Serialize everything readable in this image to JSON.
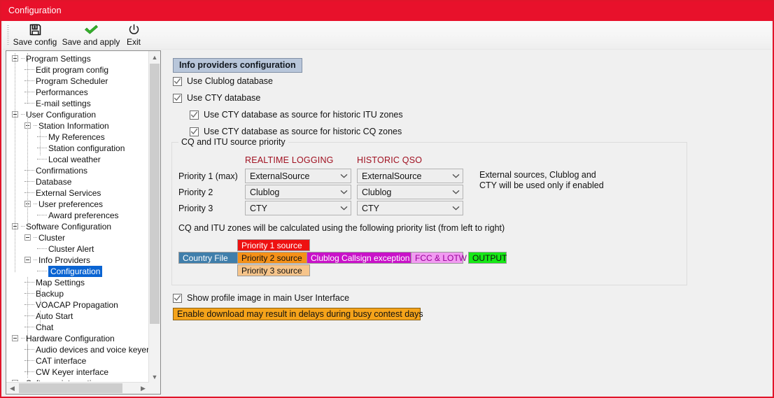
{
  "window": {
    "title": "Configuration",
    "accent_color": "#e8112b"
  },
  "toolbar": {
    "buttons": [
      {
        "label": "Save config",
        "icon": "floppy-disk-icon"
      },
      {
        "label": "Save and apply",
        "icon": "green-check-icon"
      },
      {
        "label": "Exit",
        "icon": "power-icon"
      }
    ]
  },
  "tree": {
    "items": [
      {
        "label": "Program Settings",
        "depth": 0,
        "expander": true,
        "selected": false
      },
      {
        "label": "Edit program config",
        "depth": 1,
        "expander": false,
        "selected": false
      },
      {
        "label": "Program Scheduler",
        "depth": 1,
        "expander": false,
        "selected": false
      },
      {
        "label": "Performances",
        "depth": 1,
        "expander": false,
        "selected": false
      },
      {
        "label": "E-mail settings",
        "depth": 1,
        "expander": false,
        "selected": false
      },
      {
        "label": "User Configuration",
        "depth": 0,
        "expander": true,
        "selected": false
      },
      {
        "label": "Station Information",
        "depth": 1,
        "expander": true,
        "selected": false
      },
      {
        "label": "My References",
        "depth": 2,
        "expander": false,
        "selected": false
      },
      {
        "label": "Station configuration",
        "depth": 2,
        "expander": false,
        "selected": false
      },
      {
        "label": "Local weather",
        "depth": 2,
        "expander": false,
        "selected": false
      },
      {
        "label": "Confirmations",
        "depth": 1,
        "expander": false,
        "selected": false
      },
      {
        "label": "Database",
        "depth": 1,
        "expander": false,
        "selected": false
      },
      {
        "label": "External Services",
        "depth": 1,
        "expander": false,
        "selected": false
      },
      {
        "label": "User preferences",
        "depth": 1,
        "expander": true,
        "selected": false
      },
      {
        "label": "Award preferences",
        "depth": 2,
        "expander": false,
        "selected": false
      },
      {
        "label": "Software Configuration",
        "depth": 0,
        "expander": true,
        "selected": false
      },
      {
        "label": "Cluster",
        "depth": 1,
        "expander": true,
        "selected": false
      },
      {
        "label": "Cluster Alert",
        "depth": 2,
        "expander": false,
        "selected": false
      },
      {
        "label": "Info Providers",
        "depth": 1,
        "expander": true,
        "selected": false
      },
      {
        "label": "Configuration",
        "depth": 2,
        "expander": false,
        "selected": true
      },
      {
        "label": "Map Settings",
        "depth": 1,
        "expander": false,
        "selected": false
      },
      {
        "label": "Backup",
        "depth": 1,
        "expander": false,
        "selected": false
      },
      {
        "label": "VOACAP Propagation",
        "depth": 1,
        "expander": false,
        "selected": false
      },
      {
        "label": "Auto Start",
        "depth": 1,
        "expander": false,
        "selected": false
      },
      {
        "label": "Chat",
        "depth": 1,
        "expander": false,
        "selected": false
      },
      {
        "label": "Hardware Configuration",
        "depth": 0,
        "expander": true,
        "selected": false
      },
      {
        "label": "Audio devices and voice keyer",
        "depth": 1,
        "expander": false,
        "selected": false
      },
      {
        "label": "CAT interface",
        "depth": 1,
        "expander": false,
        "selected": false
      },
      {
        "label": "CW Keyer interface",
        "depth": 1,
        "expander": false,
        "selected": false
      },
      {
        "label": "Software integration",
        "depth": 0,
        "expander": true,
        "selected": false
      }
    ]
  },
  "main": {
    "section_header": "Info providers configuration",
    "checkboxes": [
      {
        "label": "Use Clublog database",
        "checked": true
      },
      {
        "label": "Use CTY database",
        "checked": true
      },
      {
        "label": "Use CTY database as source for historic ITU zones",
        "checked": true
      },
      {
        "label": "Use CTY database as source for historic CQ zones",
        "checked": true
      }
    ],
    "group": {
      "title": "CQ and ITU source priority",
      "column_headers": [
        "REALTIME LOGGING",
        "HISTORIC QSO"
      ],
      "column_header_color": "#a01020",
      "rows": [
        {
          "label": "Priority 1 (max)",
          "realtime": "ExternalSource",
          "historic": "ExternalSource"
        },
        {
          "label": "Priority 2",
          "realtime": "Clublog",
          "historic": "Clublog"
        },
        {
          "label": "Priority 3",
          "realtime": "CTY",
          "historic": "CTY"
        }
      ],
      "note_line1": "External sources, Clublog and",
      "note_line2": "CTY will be used only if enabled",
      "priority_note": "CQ and ITU zones will be calculated using the following priority list (from left to right)",
      "badges": [
        {
          "name": "country-file",
          "text": "Country File",
          "bg": "#3f7eab",
          "fg": "#ffffff"
        },
        {
          "name": "priority-1-source",
          "text": "Priority 1 source",
          "bg": "#ee1111",
          "fg": "#ffffff"
        },
        {
          "name": "priority-2-source",
          "text": "Priority 2 source",
          "bg": "#f59118",
          "fg": "#111111"
        },
        {
          "name": "priority-3-source",
          "text": "Priority 3 source",
          "bg": "#f6c48a",
          "fg": "#111111"
        },
        {
          "name": "clublog-callsign-exception",
          "text": "Clublog Callsign exception",
          "bg": "#c912c9",
          "fg": "#ffffff"
        },
        {
          "name": "fcc-lotw",
          "text": "FCC & LOTW",
          "bg": "#f19bf1",
          "fg": "#990099"
        },
        {
          "name": "output",
          "text": "OUTPUT",
          "bg": "#16e816",
          "fg": "#111111"
        }
      ]
    },
    "profile_checkbox": {
      "label": "Show profile image in main User Interface",
      "checked": true
    },
    "warning": {
      "text": "Enable download may result in delays during busy contest days",
      "bg": "#f5a31a"
    }
  }
}
